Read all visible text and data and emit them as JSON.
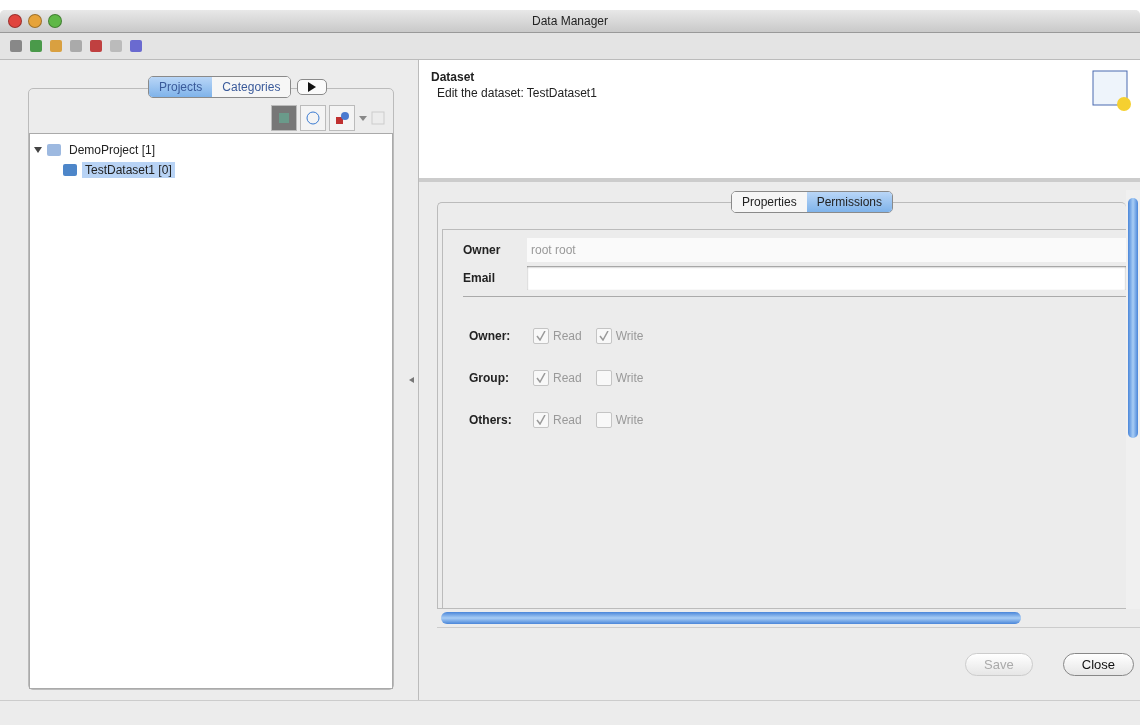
{
  "window": {
    "title": "Data Manager"
  },
  "nav_tabs": [
    {
      "label": "Projects",
      "selected": true
    },
    {
      "label": "Categories",
      "selected": false
    }
  ],
  "tree": [
    {
      "label": "DemoProject [1]",
      "expanded": true,
      "selected": false,
      "children": [
        {
          "label": "TestDataset1 [0]",
          "selected": true
        }
      ]
    }
  ],
  "editor": {
    "title": "Dataset",
    "description": "Edit the dataset: TestDataset1"
  },
  "tabs": [
    {
      "label": "Properties",
      "selected": false
    },
    {
      "label": "Permissions",
      "selected": true
    }
  ],
  "fields": [
    {
      "label": "Owner",
      "value": "root root",
      "disabled": true
    },
    {
      "label": "Email",
      "disabled": false
    }
  ],
  "permissions": [
    {
      "label": "Owner:",
      "checks": [
        {
          "label": "Read",
          "checked": true,
          "disabled": true
        },
        {
          "label": "Write",
          "checked": true,
          "disabled": true
        }
      ]
    },
    {
      "label": "Group:",
      "checks": [
        {
          "label": "Read",
          "checked": true,
          "disabled": true
        },
        {
          "label": "Write",
          "checked": false,
          "disabled": true
        }
      ]
    },
    {
      "label": "Others:",
      "checks": [
        {
          "label": "Read",
          "checked": true,
          "disabled": true
        },
        {
          "label": "Write",
          "checked": false,
          "disabled": true
        }
      ]
    }
  ],
  "buttons": [
    {
      "label": "Save",
      "disabled": true
    },
    {
      "label": "Close",
      "disabled": false
    }
  ]
}
